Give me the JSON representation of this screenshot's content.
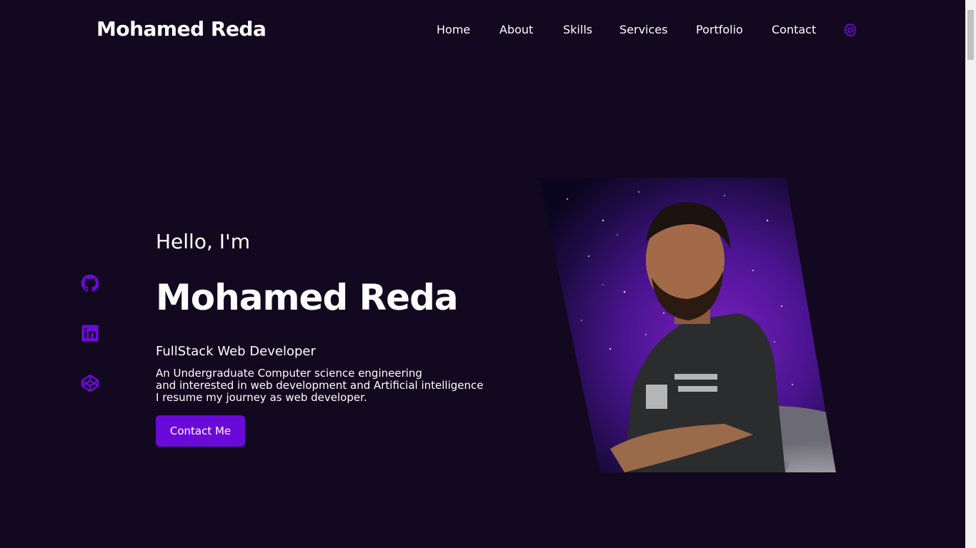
{
  "header": {
    "logo": "Mohamed Reda",
    "nav": [
      {
        "label": "Home"
      },
      {
        "label": "About"
      },
      {
        "label": "Skills"
      },
      {
        "label": "Services"
      },
      {
        "label": "Portfolio"
      },
      {
        "label": "Contact"
      }
    ],
    "settings_icon": "gear-icon"
  },
  "social": {
    "icons": [
      "github-icon",
      "linkedin-icon",
      "codepen-icon"
    ]
  },
  "hero": {
    "greeting": "Hello, I'm",
    "name": "Mohamed Reda",
    "role": "FullStack Web Developer",
    "description": [
      "An Undergraduate Computer science engineering",
      "and interested in web development and Artificial intelligence",
      "I resume my journey as web developer."
    ],
    "cta_label": "Contact Me"
  },
  "colors": {
    "background": "#12081f",
    "accent": "#6a0ad8",
    "text": "#ffffff"
  }
}
